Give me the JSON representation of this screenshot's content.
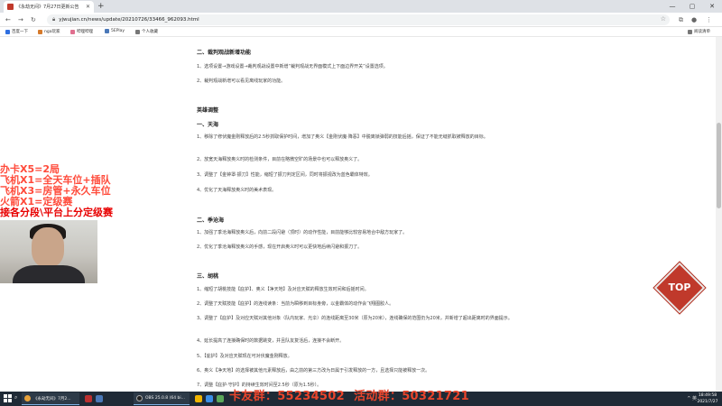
{
  "browser": {
    "tab_title": "《永劫无间》7月27日更新公告",
    "url": "yjwujian.cn/news/update/20210726/33466_962093.html",
    "bookmarks": [
      {
        "label": "百度一下",
        "color": "#2f6fe0"
      },
      {
        "label": "nga玩家",
        "color": "#d67a2b"
      },
      {
        "label": "哔哩哔哩",
        "color": "#e06f8f"
      },
      {
        "label": "5EPlay",
        "color": "#4a78b8"
      },
      {
        "label": "个人收藏",
        "color": "#777777"
      }
    ],
    "reading_list": "阅读清单"
  },
  "article": {
    "sec2_title": "二、裁判观战新增功能",
    "sec2_p1": "1、选项设置→游戏设置→裁判观战设置中新增“裁判观战无界面模式上下面边界开关”设置选项。",
    "sec2_p2": "2、裁判观战新增可以看见离线玩家的功能。",
    "hero_title": "英雄调整",
    "hero1_title": "一、天海",
    "hero1_p1": "1、移除了修伏魔金刚释放后的2.5秒抓取保护时间，增加了奥义【金刚伏魔·降恶】中脱离锁弹弱的技能后摇，保证了不能无缝抓取被释放的目标。",
    "hero1_p2": "2、放宽天海释放奥义时的检测条件，目前在略微空旷的场景中也可以释放奥义了。",
    "hero1_p3": "3、调整了【金钟罩·振刀】性能，缩短了振刀判定区间，同时将振视改为蓝色霸体特效。",
    "hero1_p4": "4、优化了天海释放奥义时的美术表现。",
    "hero2_title": "二、季沧海",
    "hero2_p1": "1、加强了季沧海释放奥义后，向前二段闪避（顶时）的动作性能，目前能够比较容易地合中敌方玩家了。",
    "hero2_p2": "2、优化了季沧海释放奥义的手感，现在开启奥义时可以更快地后续闪避和振刀了。",
    "hero3_title": "三、胡桃",
    "hero3_p1": "1、缩短了胡桃技能【庇护】、奥义【净天地】及对应天赋的释放生效时间和后摇时间。",
    "hero3_p2": "2、调整了天赋技能【庇护】的连线读条：当前为瞬移到目标身旁，以金霸体的动作会飞翔图胶人。",
    "hero3_p3": "3、调整了【庇护】及对应天赋对其他对象（队内玩家、光伞）的连线距离至30米（原为20米），连线确保的范围仍为20米，并新增了超出距离时的界面提示。",
    "hero3_p4": "4、延长提高了连接确保时的数据跳变，并且队友复活后，连接不会断开。",
    "hero3_p5": "5、【庇护】及对应天赋现在可对伏魔金刚释放。",
    "hero3_p6": "6、奥义【净天地】的选择被其他元素释放后，由之前的第三方改为日属于引发释放的一方，且选择只能被释放一次。",
    "hero3_p7": "7、调整【庇护·守护】的持续生效时间至2.5秒（原为1.5秒）。"
  },
  "overlay": {
    "line1": "办卡X5=2局",
    "line2": "飞机X1=全天车位+插队",
    "line3": "飞机X3=房管+永久车位",
    "line4": "火箭X1=定级赛",
    "line5": "接各分段\\平台上分定级赛",
    "line1_color": "#ff4a3a",
    "line2_color": "#ff4a3a",
    "line3_color": "#ff4a3a",
    "line4_color": "#ff4a3a",
    "line5_color": "#e80000"
  },
  "top_button": {
    "label": "TOP"
  },
  "taskbar": {
    "search_icon": "search-icon",
    "apps": [
      {
        "label": "《永劫无间》7月2...",
        "color": "#e8a23b"
      },
      {
        "label": "",
        "color": "#bb3030"
      },
      {
        "label": "",
        "color": "#4a78b8"
      },
      {
        "label": "OBS 25.0.8 (64 bi...",
        "color": "#222222"
      },
      {
        "label": "",
        "color": "#f0b400"
      },
      {
        "label": "",
        "color": "#3a8ee6"
      },
      {
        "label": "",
        "color": "#5aa85a"
      }
    ],
    "banner1": "卡友群：55234502",
    "banner2": "活动群：50321721",
    "tray_text": "^  英",
    "time": "18:49:58",
    "date": "2021/7/27"
  }
}
